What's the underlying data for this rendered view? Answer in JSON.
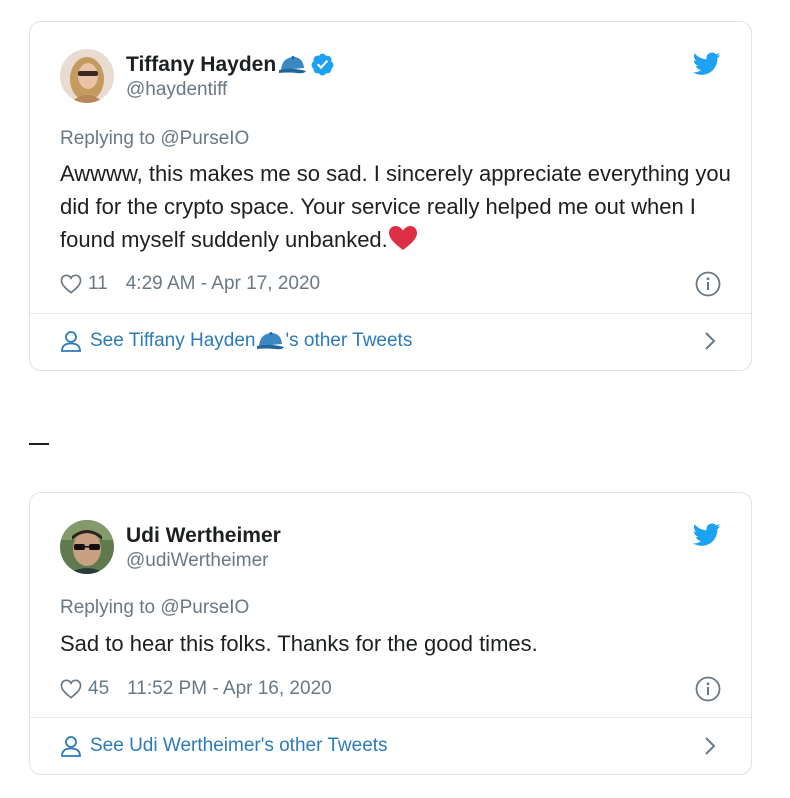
{
  "tweets": [
    {
      "display_name": "Tiffany Hayden",
      "handle": "@haydentiff",
      "verified": true,
      "name_emoji": "blue-cap-emoji",
      "replying_prefix": "Replying to ",
      "replying_to": "@PurseIO",
      "text": "Awwww, this makes me so sad. I sincerely appreciate everything you did for the crypto space. Your service really helped me out when I found myself suddenly unbanked.",
      "text_emoji": "red-heart-emoji",
      "likes": "11",
      "timestamp": "4:29 AM - Apr 17, 2020",
      "footer_prefix": "See Tiffany Hayden",
      "footer_suffix": "'s other Tweets"
    },
    {
      "display_name": "Udi Wertheimer",
      "handle": "@udiWertheimer",
      "verified": false,
      "replying_prefix": "Replying to ",
      "replying_to": "@PurseIO",
      "text": "Sad to hear this folks. Thanks for the good times.",
      "likes": "45",
      "timestamp": "11:52 PM - Apr 16, 2020",
      "footer_text": "See Udi Wertheimer's other Tweets"
    }
  ],
  "separator": "—",
  "colors": {
    "twitter_blue": "#1da1f2",
    "link_blue": "#2b7bb9",
    "secondary_text": "#697882",
    "primary_text": "#1c2022",
    "border": "#dfe3e7",
    "heart_red": "#e0245e"
  }
}
